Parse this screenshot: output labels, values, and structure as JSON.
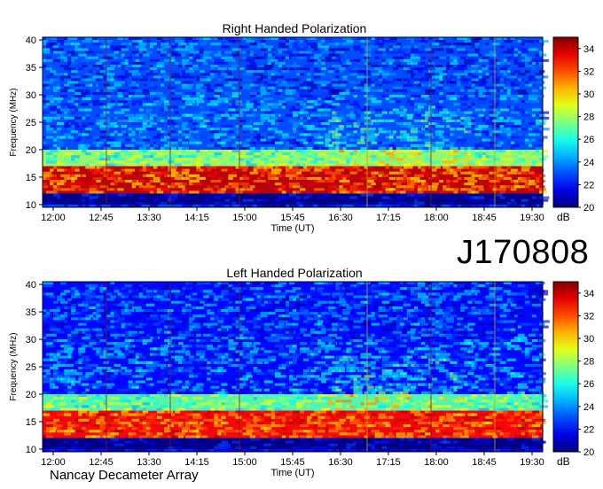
{
  "observation_id": "J170808",
  "instrument": "Nancay Decameter Array",
  "colors": {
    "background": "#ffffff",
    "spectrogram_low": "#0a1fb3",
    "spectrogram_mid": "#22d3e6",
    "spectrogram_high": "#a80000",
    "marker_lines": "#8b1a1a",
    "marker_lines_alt": "#c8a800"
  },
  "chart_data": [
    {
      "type": "heatmap",
      "title": "Right Handed Polarization",
      "xlabel": "Time (UT)",
      "ylabel": "Frequency (MHz)",
      "x_ticks": [
        "12:00",
        "12:45",
        "13:30",
        "14:15",
        "15:00",
        "15:45",
        "16:30",
        "17:15",
        "18:00",
        "18:45",
        "19:30"
      ],
      "x_range": [
        "11:50",
        "19:40"
      ],
      "y_ticks": [
        10,
        15,
        20,
        25,
        30,
        35,
        40
      ],
      "ylim": [
        9.5,
        40.5
      ],
      "colorbar": {
        "label": "dB",
        "ticks": [
          20,
          22,
          24,
          26,
          28,
          30,
          32,
          34
        ],
        "range": [
          20,
          35
        ]
      },
      "vertical_markers": [
        "12:50",
        "13:50",
        "14:55",
        "16:55",
        "17:55",
        "18:55"
      ],
      "features": [
        {
          "freq_min": 10,
          "freq_max": 12,
          "level_db": 20
        },
        {
          "freq_min": 12,
          "freq_max": 17,
          "level_db": 34
        },
        {
          "freq_min": 17,
          "freq_max": 20,
          "level_db": 28
        },
        {
          "freq_min": 20,
          "freq_max": 40,
          "level_db": 23
        }
      ]
    },
    {
      "type": "heatmap",
      "title": "Left Handed Polarization",
      "xlabel": "Time (UT)",
      "ylabel": "Frequency (MHz)",
      "x_ticks": [
        "12:00",
        "12:45",
        "13:30",
        "14:15",
        "15:00",
        "15:45",
        "16:30",
        "17:15",
        "18:00",
        "18:45",
        "19:30"
      ],
      "x_range": [
        "11:50",
        "19:40"
      ],
      "y_ticks": [
        10,
        15,
        20,
        25,
        30,
        35,
        40
      ],
      "ylim": [
        9.5,
        40.5
      ],
      "colorbar": {
        "label": "dB",
        "ticks": [
          20,
          22,
          24,
          26,
          28,
          30,
          32,
          34
        ],
        "range": [
          20,
          35
        ]
      },
      "vertical_markers": [
        "12:50",
        "13:50",
        "14:55",
        "16:55",
        "17:55",
        "18:55"
      ],
      "features": [
        {
          "freq_min": 10,
          "freq_max": 12,
          "level_db": 20
        },
        {
          "freq_min": 12,
          "freq_max": 17,
          "level_db": 33
        },
        {
          "freq_min": 17,
          "freq_max": 20,
          "level_db": 27
        },
        {
          "freq_min": 20,
          "freq_max": 40,
          "level_db": 22
        }
      ]
    }
  ]
}
